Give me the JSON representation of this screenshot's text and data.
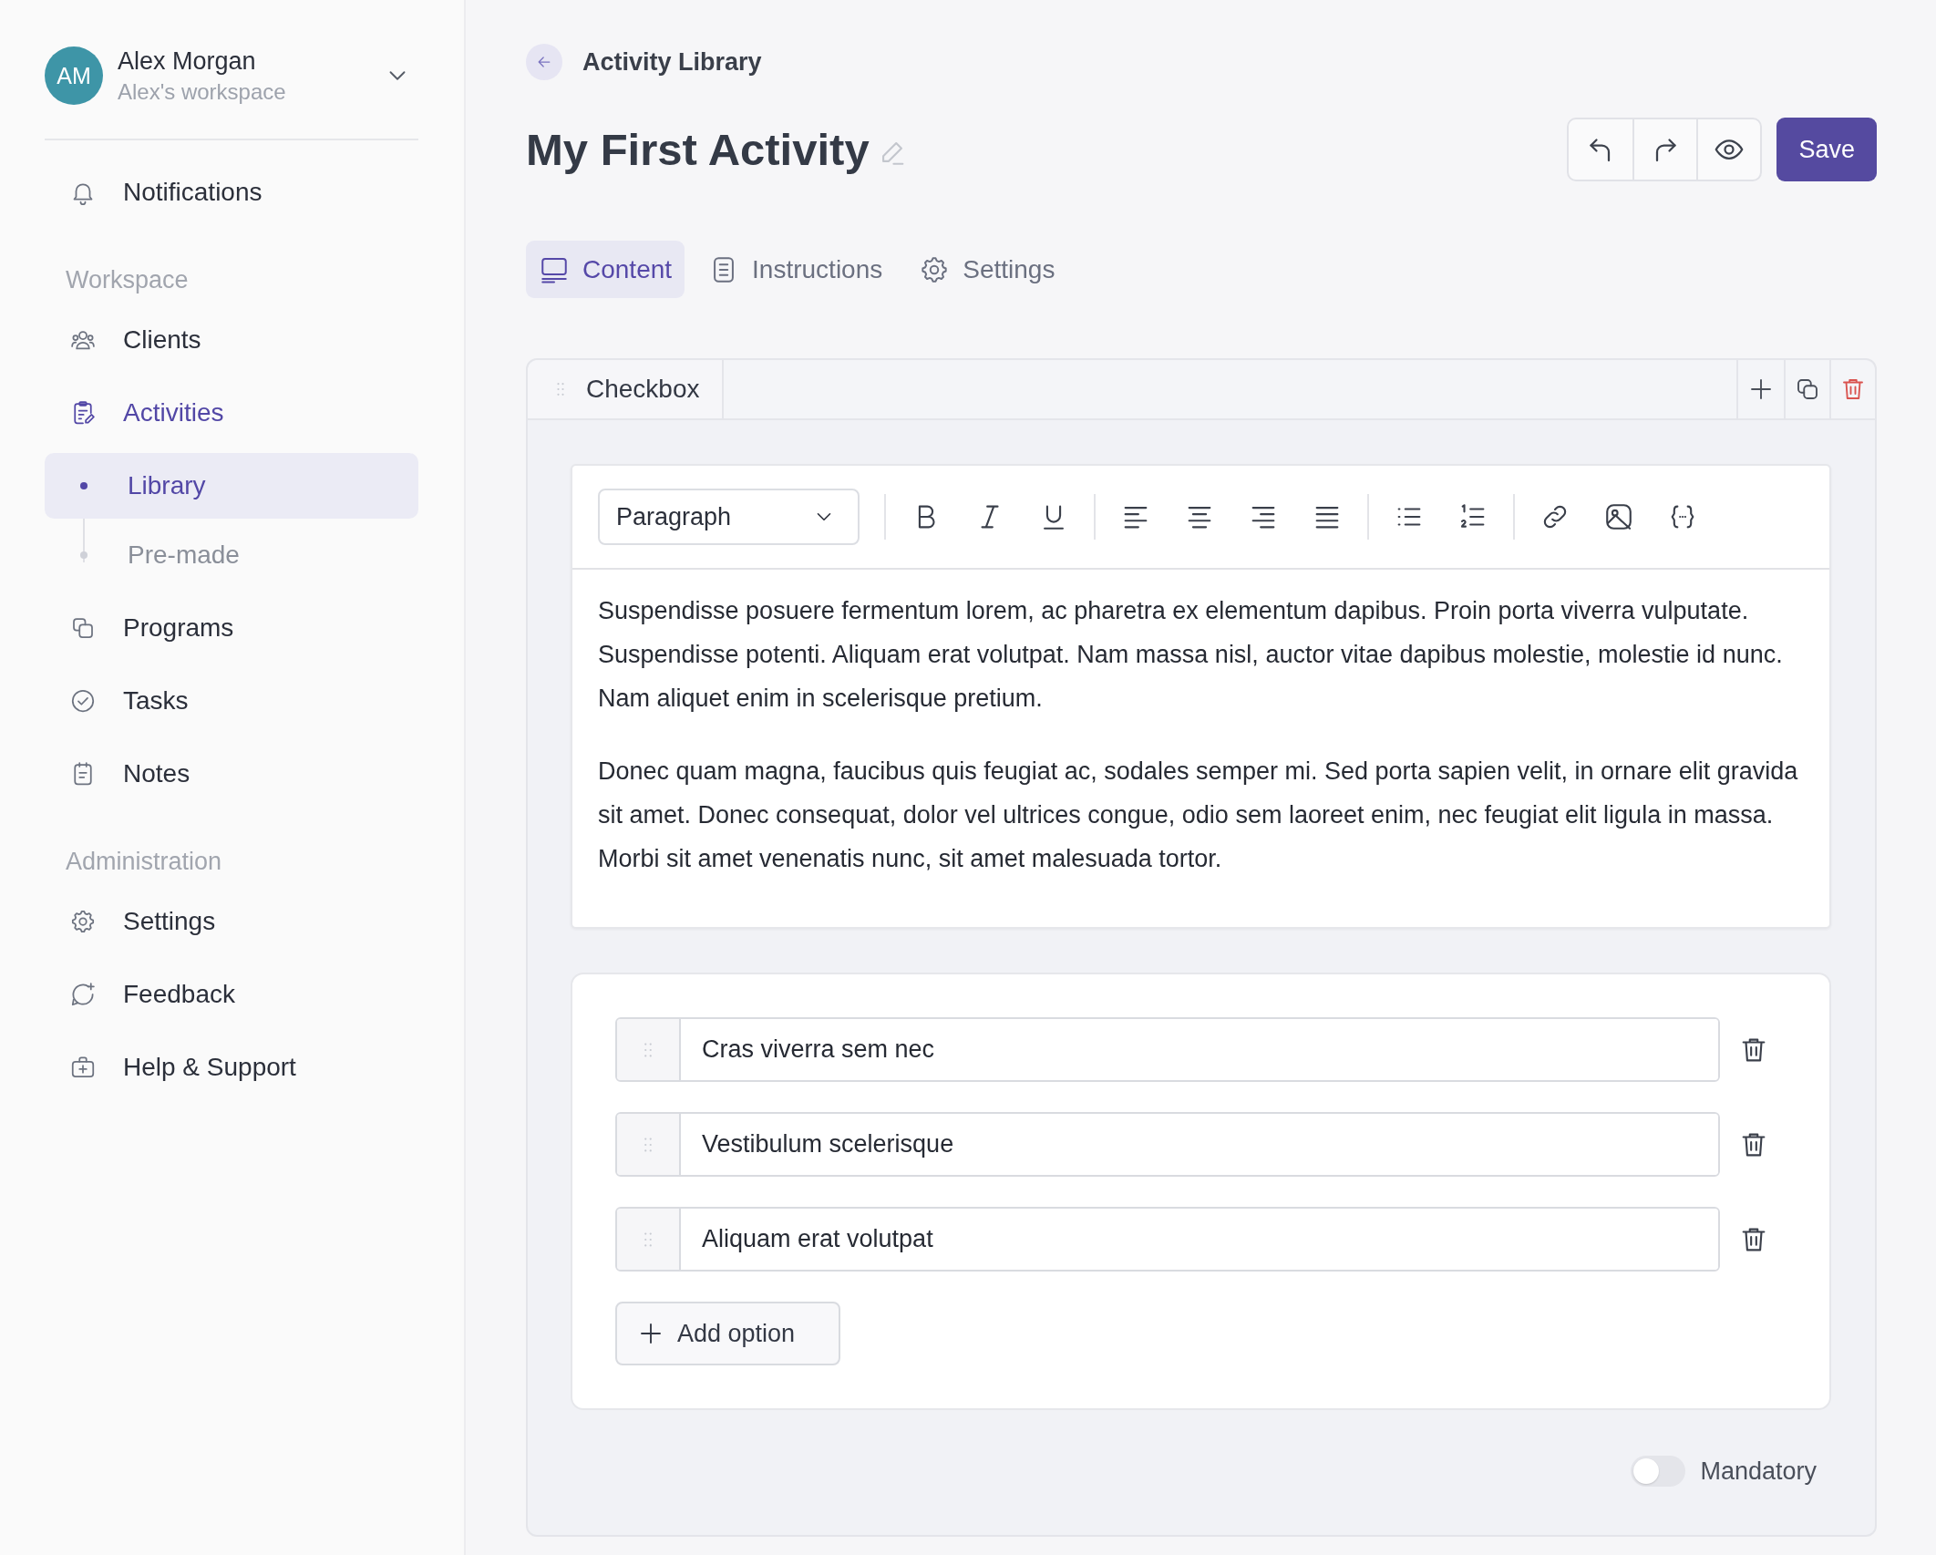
{
  "user": {
    "initials": "AM",
    "name": "Alex Morgan",
    "workspace": "Alex's workspace"
  },
  "sidebar": {
    "top_items": [
      {
        "label": "Notifications",
        "kind": "bell",
        "selected": false
      }
    ],
    "sections": [
      {
        "title": "Workspace",
        "items": [
          {
            "label": "Clients",
            "kind": "users",
            "selected": false
          },
          {
            "label": "Activities",
            "kind": "clipboard",
            "selected": true,
            "children": [
              {
                "label": "Library",
                "selected": true
              },
              {
                "label": "Pre-made",
                "selected": false
              }
            ]
          },
          {
            "label": "Programs",
            "kind": "squares",
            "selected": false
          },
          {
            "label": "Tasks",
            "kind": "check",
            "selected": false
          },
          {
            "label": "Notes",
            "kind": "note",
            "selected": false
          }
        ]
      },
      {
        "title": "Administration",
        "items": [
          {
            "label": "Settings",
            "kind": "gear",
            "selected": false
          },
          {
            "label": "Feedback",
            "kind": "chat",
            "selected": false
          },
          {
            "label": "Help & Support",
            "kind": "kit",
            "selected": false
          }
        ]
      }
    ]
  },
  "breadcrumb": "Activity Library",
  "title": "My First Activity",
  "save_button": "Save",
  "tabs": [
    {
      "label": "Content",
      "kind": "monitor",
      "selected": true
    },
    {
      "label": "Instructions",
      "kind": "document",
      "selected": false
    },
    {
      "label": "Settings",
      "kind": "gear",
      "selected": false
    }
  ],
  "block": {
    "type_label": "Checkbox",
    "editor": {
      "block_style": "Paragraph",
      "paragraphs": [
        "Suspendisse posuere fermentum lorem, ac pharetra ex elementum dapibus. Proin porta viverra vulputate. Suspendisse potenti. Aliquam erat volutpat. Nam massa nisl, auctor vitae dapibus molestie, molestie id nunc. Nam aliquet enim in scelerisque pretium.",
        "Donec quam magna, faucibus quis feugiat ac, sodales semper mi. Sed porta sapien velit, in ornare elit gravida sit amet. Donec consequat, dolor vel ultrices congue, odio sem laoreet enim, nec feugiat elit ligula in massa. Morbi sit amet venenatis nunc, sit amet malesuada tortor."
      ]
    },
    "options": [
      {
        "value": "Cras viverra sem nec"
      },
      {
        "value": "Vestibulum scelerisque"
      },
      {
        "value": "Aliquam erat volutpat"
      }
    ],
    "add_option": "Add option",
    "mandatory": {
      "label": "Mandatory",
      "on": false
    }
  }
}
